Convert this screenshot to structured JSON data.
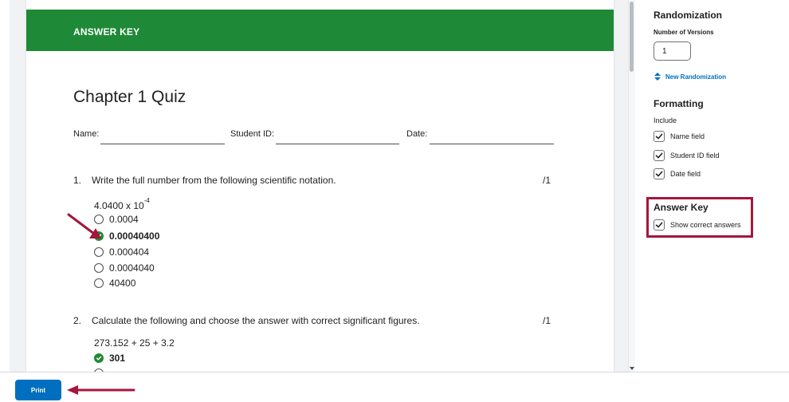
{
  "preview": {
    "banner_title": "ANSWER KEY",
    "quiz_title": "Chapter 1 Quiz",
    "fields": [
      {
        "label": "Name:"
      },
      {
        "label": "Student ID:"
      },
      {
        "label": "Date:"
      }
    ],
    "questions": [
      {
        "number": "1.",
        "text": "Write the full number from the following scientific notation.",
        "points": "/1",
        "expression_base": "4.0400 x 10",
        "expression_exp": "-4",
        "options": [
          {
            "text": "0.0004",
            "correct": false
          },
          {
            "text": "0.00040400",
            "correct": true
          },
          {
            "text": "0.000404",
            "correct": false
          },
          {
            "text": "0.0004040",
            "correct": false
          },
          {
            "text": "40400",
            "correct": false
          }
        ]
      },
      {
        "number": "2.",
        "text": "Calculate the following and choose the answer with correct significant figures.",
        "points": "/1",
        "expression": "273.152 + 25 + 3.2",
        "options": [
          {
            "text": "301",
            "correct": true
          },
          {
            "text": "",
            "correct": false
          }
        ]
      }
    ]
  },
  "sidebar": {
    "randomization": {
      "heading": "Randomization",
      "versions_label": "Number of Versions",
      "versions_value": "1",
      "new_randomization_label": "New Randomization",
      "new_randomization_icon": "shuffle-icon"
    },
    "formatting": {
      "heading": "Formatting",
      "include_label": "Include",
      "items": [
        {
          "label": "Name field",
          "checked": true
        },
        {
          "label": "Student ID field",
          "checked": true
        },
        {
          "label": "Date field",
          "checked": true
        }
      ]
    },
    "answer_key": {
      "heading": "Answer Key",
      "item": {
        "label": "Show correct answers",
        "checked": true
      }
    }
  },
  "footer": {
    "print_label": "Print"
  },
  "colors": {
    "banner": "#1e8a37",
    "correct": "#1e8a37",
    "accent": "#006fbf",
    "annotation": "#a3163d"
  }
}
